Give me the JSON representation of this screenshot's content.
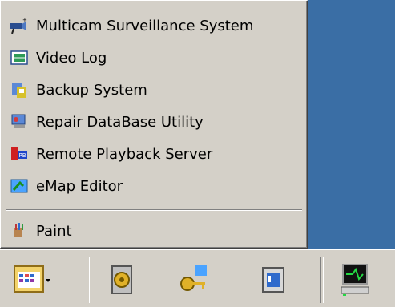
{
  "menu": {
    "items": [
      {
        "label": "Multicam Surveillance System",
        "icon": "surveillance-camera-icon"
      },
      {
        "label": "Video Log",
        "icon": "video-log-icon"
      },
      {
        "label": "Backup System",
        "icon": "backup-system-icon"
      },
      {
        "label": "Repair DataBase Utility",
        "icon": "repair-database-icon"
      },
      {
        "label": "Remote Playback Server",
        "icon": "remote-playback-icon"
      },
      {
        "label": "eMap Editor",
        "icon": "emap-editor-icon"
      }
    ],
    "extra_items": [
      {
        "label": "Paint",
        "icon": "paint-icon"
      }
    ]
  },
  "taskbar": {
    "icons": [
      "program-folder-icon",
      "settings-gear-icon",
      "key-icon",
      "speaker-icon",
      "computer-monitor-icon"
    ]
  },
  "colors": {
    "desktop": "#3a6ea5",
    "menu_bg": "#d4d0c8"
  }
}
